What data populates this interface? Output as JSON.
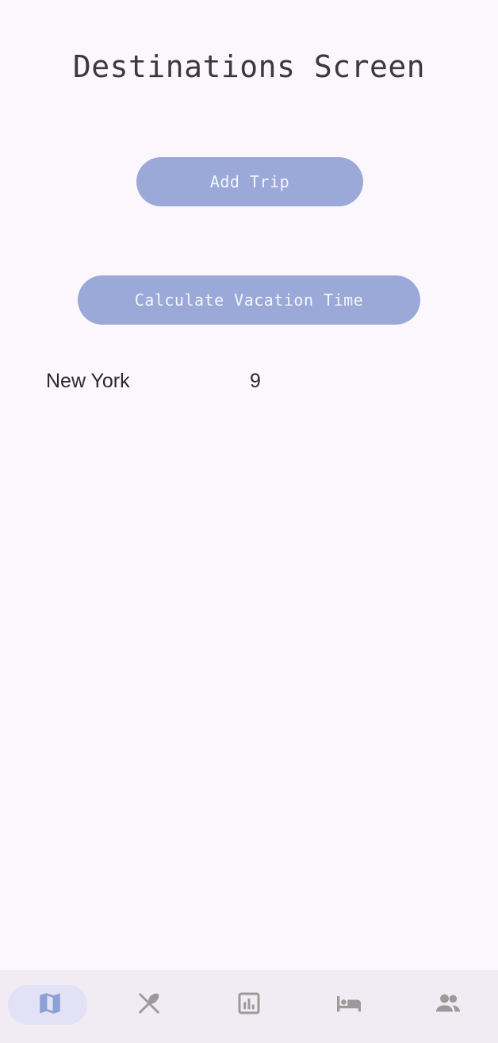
{
  "screen": {
    "title": "Destinations Screen"
  },
  "actions": {
    "add_trip_label": "Add Trip",
    "calculate_label": "Calculate Vacation Time"
  },
  "destinations": [
    {
      "name": "New York",
      "value": "9"
    }
  ],
  "bottom_nav": {
    "items": [
      {
        "icon": "map-icon",
        "selected": true
      },
      {
        "icon": "restaurant-icon",
        "selected": false
      },
      {
        "icon": "chart-icon",
        "selected": false
      },
      {
        "icon": "bed-icon",
        "selected": false
      },
      {
        "icon": "people-icon",
        "selected": false
      }
    ]
  },
  "colors": {
    "background": "#fcf7fc",
    "button": "#9aa9d8",
    "button_text": "#f4f6fc",
    "nav_background": "#f1ecf3",
    "nav_selected_pill": "#e2e1f5",
    "nav_selected_icon": "#8e9fd6",
    "nav_icon": "#9a9a9a"
  }
}
